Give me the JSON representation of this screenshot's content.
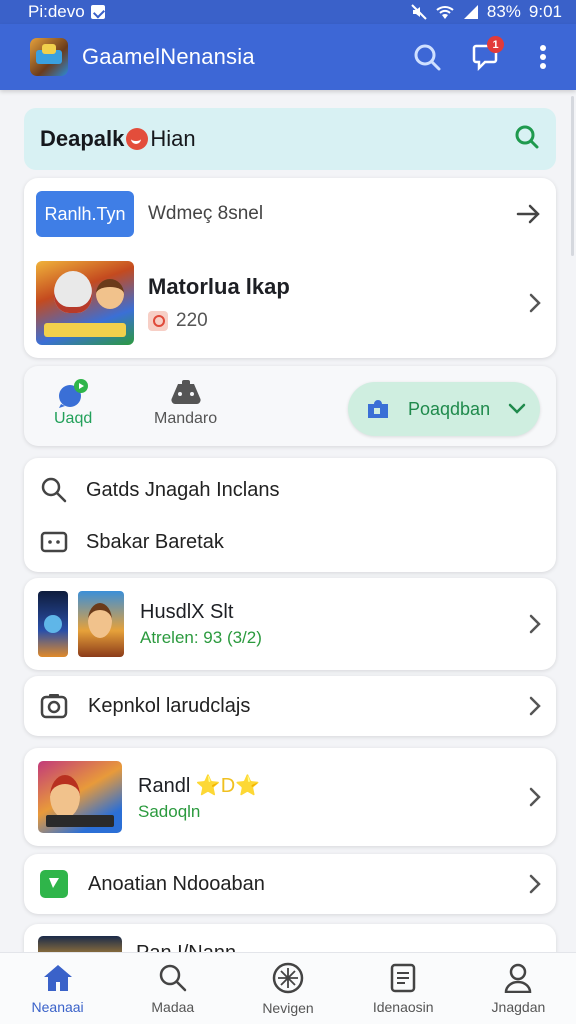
{
  "status_bar": {
    "left_text": "Pi:devo",
    "battery": "83%",
    "time": "9:01"
  },
  "app_bar": {
    "title": "GaamelNenansia",
    "notification_count": "1"
  },
  "search_card": {
    "title_part1": "Deapalk",
    "title_part2": "Hian"
  },
  "featured_card": {
    "button_label": "Ranlh.Tyn",
    "label": "Wdmeç 8snel",
    "game_title": "Matorlua lkap",
    "game_meta": "220"
  },
  "tabs": {
    "tab1_label": "Uaqd",
    "tab2_label": "Mandaro",
    "pill_label": "Poaqdban"
  },
  "list_card": {
    "row1": "Gatds Jnagah Inclans",
    "row2": "Sbakar Baretak"
  },
  "game_list": [
    {
      "title": "HusdlX Slt",
      "subtitle": "Atrelen: 93 (3/2)"
    },
    {
      "title": "Kepnkol larudclajs"
    },
    {
      "title": "Randl",
      "stars": "⭐D⭐",
      "subtitle": "Sadoqln"
    },
    {
      "title": "Anoatian Ndooaban"
    },
    {
      "title": "Pan I/Nann"
    }
  ],
  "bottom_nav": [
    {
      "label": "Neanaai",
      "icon": "home-icon"
    },
    {
      "label": "Madaa",
      "icon": "search-icon"
    },
    {
      "label": "Nevigen",
      "icon": "compass-icon"
    },
    {
      "label": "Idenaosin",
      "icon": "document-icon"
    },
    {
      "label": "Jnagdan",
      "icon": "profile-icon"
    }
  ],
  "colors": {
    "primary": "#3d67d6",
    "accent_green": "#2b9a3e",
    "search_bg": "#d8f1f3"
  }
}
